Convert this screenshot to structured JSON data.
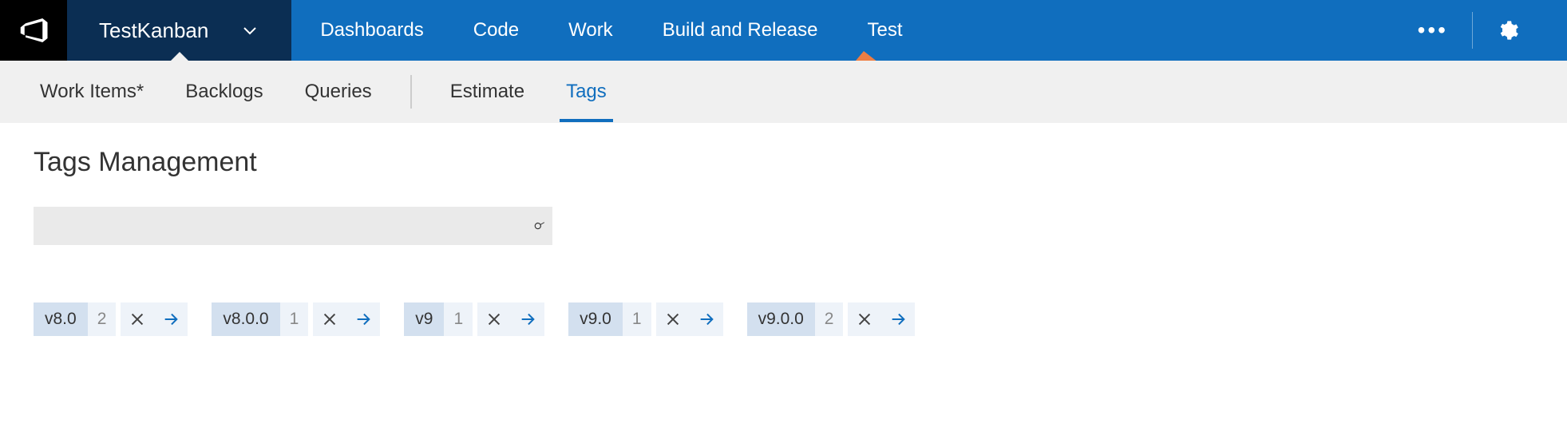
{
  "header": {
    "project_name": "TestKanban",
    "nav": {
      "dashboards": "Dashboards",
      "code": "Code",
      "work": "Work",
      "build_release": "Build and Release",
      "test": "Test"
    }
  },
  "subnav": {
    "work_items": "Work Items*",
    "backlogs": "Backlogs",
    "queries": "Queries",
    "estimate": "Estimate",
    "tags": "Tags"
  },
  "page": {
    "title": "Tags Management",
    "search_placeholder": ""
  },
  "tags": [
    {
      "name": "v8.0",
      "count": "2"
    },
    {
      "name": "v8.0.0",
      "count": "1"
    },
    {
      "name": "v9",
      "count": "1"
    },
    {
      "name": "v9.0",
      "count": "1"
    },
    {
      "name": "v9.0.0",
      "count": "2"
    }
  ],
  "colors": {
    "brand_blue": "#106ebe",
    "dark_blue": "#0b2e53",
    "chip_bg": "#d3e0ef",
    "chip_light": "#eef3f9",
    "annotation_orange": "#ee7e43"
  }
}
